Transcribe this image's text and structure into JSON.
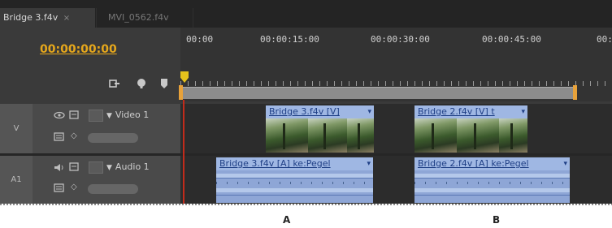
{
  "tabs": [
    {
      "label": "Bridge 3.f4v",
      "close": "×",
      "active": true
    },
    {
      "label": "MVI_0562.f4v",
      "active": false
    }
  ],
  "header": {
    "timecode": "00:00:00:00",
    "icons": [
      "snap-icon",
      "add-marker-icon",
      "marker-icon"
    ]
  },
  "ruler": {
    "labels": [
      "00:00",
      "00:00:15:00",
      "00:00:30:00",
      "00:00:45:00",
      "00:"
    ]
  },
  "tracks": {
    "video": {
      "id": "V",
      "name": "Video 1",
      "collapse": "▼"
    },
    "audio": {
      "id": "A1",
      "name": "Audio 1",
      "collapse": "▼"
    }
  },
  "clips": {
    "video_a": {
      "title": "Bridge 3.f4v [V]",
      "menu": "▾"
    },
    "video_b": {
      "title": "Bridge 2.f4v [V]  t",
      "menu": "▾"
    },
    "audio_a": {
      "title": "Bridge 3.f4v [A]  ke:Pegel",
      "menu": "▾"
    },
    "audio_b": {
      "title": "Bridge 2.f4v [A]  ke:Pegel",
      "menu": "▾"
    }
  },
  "markers": [
    "A",
    "B"
  ],
  "colors": {
    "timecode": "#e5a71c",
    "playhead_line": "#c22b1b",
    "clip_title_bg": "#9fb7e3",
    "audio_wave": "#8ea6d6",
    "workarea_cap": "#e8a23a"
  }
}
